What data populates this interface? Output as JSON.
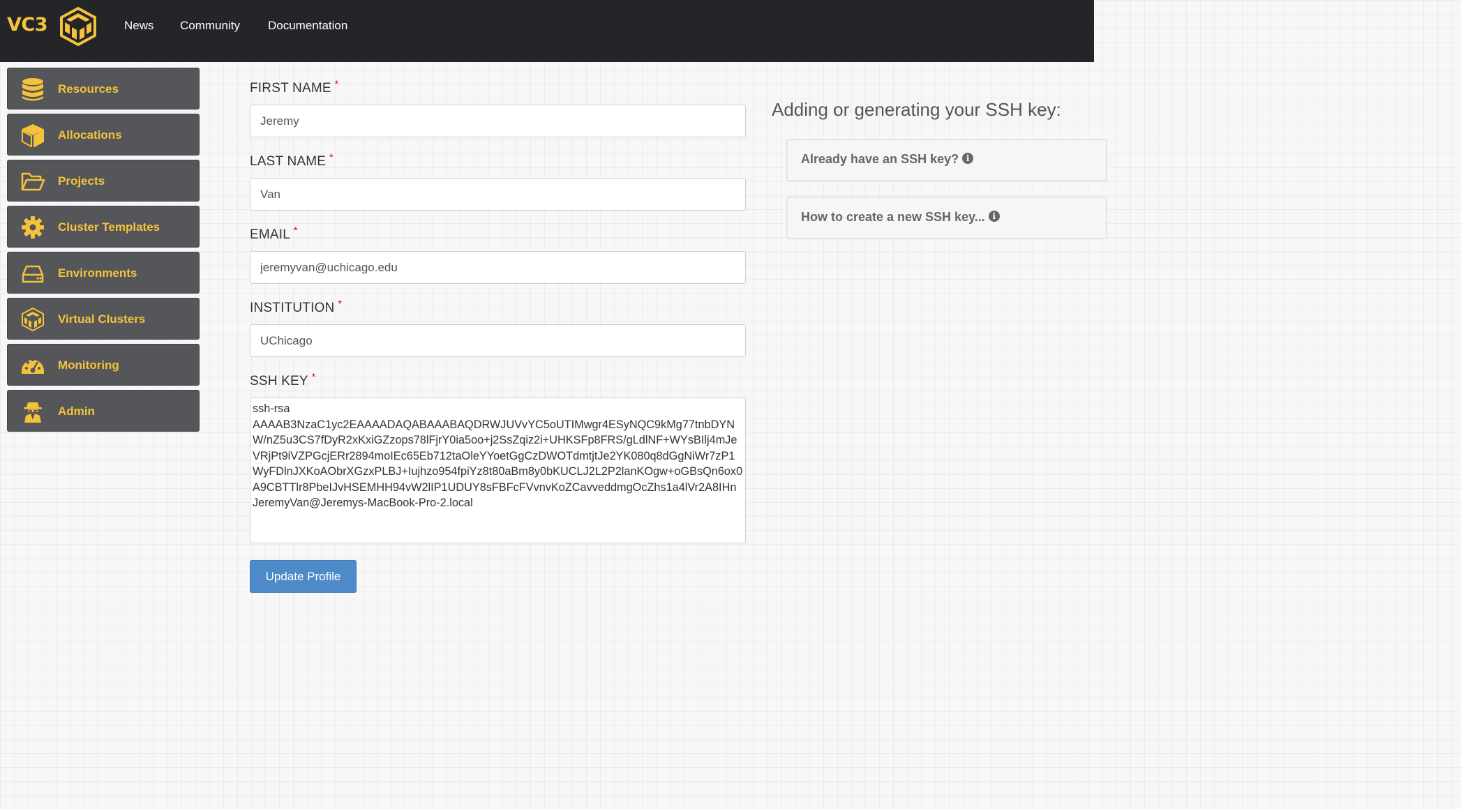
{
  "navbar": {
    "brand": "VC3",
    "links": [
      "News",
      "Community",
      "Documentation"
    ]
  },
  "sidebar": {
    "items": [
      {
        "label": "Resources",
        "icon": "database-icon"
      },
      {
        "label": "Allocations",
        "icon": "cube-icon"
      },
      {
        "label": "Projects",
        "icon": "folder-open-icon"
      },
      {
        "label": "Cluster Templates",
        "icon": "gear-icon"
      },
      {
        "label": "Environments",
        "icon": "hard-drive-icon"
      },
      {
        "label": "Virtual Clusters",
        "icon": "vc3-cluster-icon"
      },
      {
        "label": "Monitoring",
        "icon": "dashboard-gauge-icon"
      },
      {
        "label": "Admin",
        "icon": "user-secret-icon"
      }
    ]
  },
  "form": {
    "required_marker": "*",
    "first_name": {
      "label": "FIRST NAME",
      "value": "Jeremy"
    },
    "last_name": {
      "label": "LAST NAME",
      "value": "Van"
    },
    "email": {
      "label": "EMAIL",
      "value": "jeremyvan@uchicago.edu"
    },
    "institution": {
      "label": "INSTITUTION",
      "value": "UChicago"
    },
    "ssh_key": {
      "label": "SSH KEY",
      "value": "ssh-rsa\nAAAAB3NzaC1yc2EAAAADAQABAAABAQDRWJUVvYC5oUTIMwgr4ESyNQC9kMg77tnbDYNW/nZ5u3CS7fDyR2xKxiGZzops78lFjrY0ia5oo+j2SsZqiz2i+UHKSFp8FRS/gLdlNF+WYsBIlj4mJeVRjPt9iVZPGcjERr2894moIEc65Eb712taOleYYoetGgCzDWOTdmtjtJe2YK080q8dGgNiWr7zP1WyFDlnJXKoAObrXGzxPLBJ+Iujhzo954fpiYz8t80aBm8y0bKUCLJ2L2P2lanKOgw+oGBsQn6ox0A9CBTTlr8PbeIJvHSEMHH94vW2lIP1UDUY8sFBFcFVvnvKoZCavveddmgOcZhs1a4lVr2A8IHn JeremyVan@Jeremys-MacBook-Pro-2.local"
    },
    "submit_label": "Update Profile"
  },
  "help": {
    "title": "Adding or generating your SSH key:",
    "cards": [
      {
        "label": "Already have an SSH key?",
        "icon": "info-circle-icon"
      },
      {
        "label": "How to create a new SSH key...",
        "icon": "info-circle-icon"
      }
    ],
    "info_glyph": "i"
  },
  "colors": {
    "navbar": "#232528",
    "accent": "#f5c33b",
    "sidebar_item": "#555659",
    "button": "#4d8ac7",
    "required": "#d0021b"
  }
}
